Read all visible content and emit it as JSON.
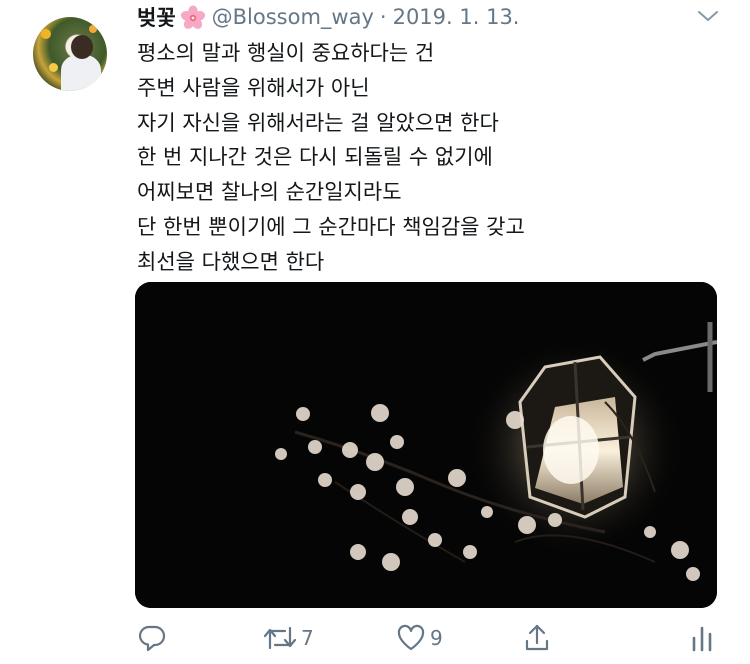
{
  "tweet": {
    "display_name": "벚꽃",
    "name_emoji": "cherry-blossom-emoji",
    "handle": "@Blossom_way",
    "separator": "·",
    "date": "2019. 1. 13.",
    "lines": [
      "평소의 말과 행실이 중요하다는 건",
      "주변 사람을 위해서가 아닌",
      "자기 자신을 위해서라는 걸 알았으면 한다",
      "한 번 지나간 것은 다시 되돌릴 수 없기에",
      "어찌보면 찰나의 순간일지라도",
      "단 한번 뿐이기에 그 순간마다 책임감을 갖고",
      "최선을 다했으면 한다"
    ],
    "media": {
      "icon": "photo-night-lantern-blossoms"
    }
  },
  "actions": {
    "reply": {
      "icon": "reply-icon",
      "count": ""
    },
    "retweet": {
      "icon": "retweet-icon",
      "count": "7"
    },
    "like": {
      "icon": "heart-icon",
      "count": "9"
    },
    "share": {
      "icon": "share-icon"
    },
    "analytics": {
      "icon": "analytics-icon"
    }
  },
  "colors": {
    "text": "#14171a",
    "secondary": "#657786",
    "background": "#ffffff",
    "blossom_pink": "#f06292"
  }
}
